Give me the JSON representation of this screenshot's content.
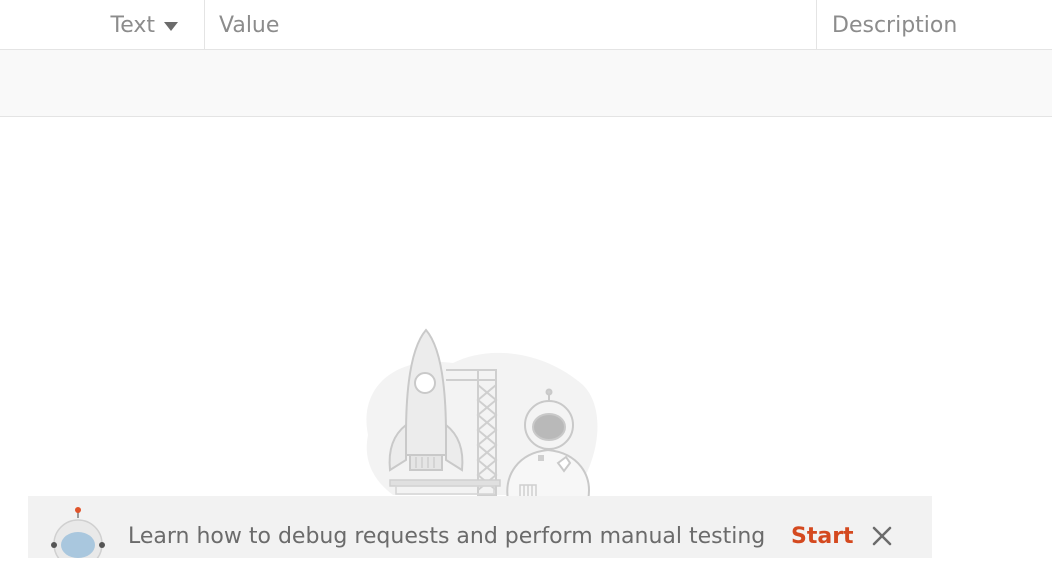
{
  "table": {
    "columns": {
      "type_label": "Text",
      "value_label": "Value",
      "description_label": "Description"
    }
  },
  "banner": {
    "message": "Learn how to debug requests and perform manual testing",
    "start_label": "Start"
  },
  "colors": {
    "accent": "#d4491f",
    "border": "#e4e4e4",
    "row_bg": "#f9f9f9",
    "banner_bg": "#f2f2f2"
  },
  "icons": {
    "type_dropdown": "caret-down-icon",
    "close": "close-icon",
    "illustration": "rocket-launch-illustration",
    "avatar": "astronaut-avatar-icon"
  }
}
